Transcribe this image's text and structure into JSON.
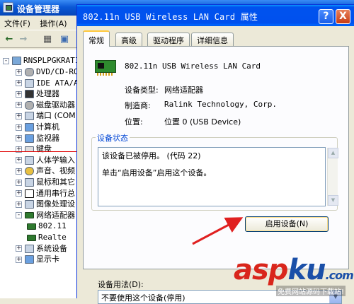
{
  "device_manager": {
    "title": "设备管理器",
    "menu": [
      "文件(F)",
      "操作(A)"
    ],
    "tree": {
      "root": "RNSPLPGKRATI",
      "items": [
        {
          "label": "DVD/CD-RO",
          "expander": "+",
          "icon": "dvd-icon"
        },
        {
          "label": "IDE ATA/A",
          "expander": "+",
          "icon": "ide-icon"
        },
        {
          "label": "处理器",
          "expander": "+",
          "icon": "cpu-icon"
        },
        {
          "label": "磁盘驱动器",
          "expander": "+",
          "icon": "disk-icon"
        },
        {
          "label": "端口 (COM",
          "expander": "+",
          "icon": "port-icon"
        },
        {
          "label": "计算机",
          "expander": "+",
          "icon": "computer-icon"
        },
        {
          "label": "监视器",
          "expander": "+",
          "icon": "monitor-icon"
        },
        {
          "label": "键盘",
          "expander": "+",
          "icon": "keyboard-icon"
        },
        {
          "label": "人体学输入",
          "expander": "+",
          "icon": "hid-icon"
        },
        {
          "label": "声音、视频",
          "expander": "+",
          "icon": "sound-icon"
        },
        {
          "label": "鼠标和其它",
          "expander": "+",
          "icon": "mouse-icon"
        },
        {
          "label": "通用串行总",
          "expander": "+",
          "icon": "usb-icon"
        },
        {
          "label": "图像处理设",
          "expander": "+",
          "icon": "camera-icon"
        },
        {
          "label": "网络适配器",
          "expander": "-",
          "icon": "network-icon"
        },
        {
          "label": "802.11",
          "expander": "",
          "icon": "network-card-icon",
          "child": true
        },
        {
          "label": "Realte",
          "expander": "",
          "icon": "network-card-icon",
          "child": true
        },
        {
          "label": "系统设备",
          "expander": "+",
          "icon": "system-icon"
        },
        {
          "label": "显示卡",
          "expander": "+",
          "icon": "display-icon"
        }
      ]
    }
  },
  "dialog": {
    "title": "802.11n USB Wireless LAN Card 属性",
    "help_btn": "?",
    "close_btn": "X",
    "tabs": [
      "常规",
      "高级",
      "驱动程序",
      "详细信息"
    ],
    "device_name": "802.11n USB Wireless LAN Card",
    "properties": [
      {
        "label": "设备类型:",
        "value": "网络适配器"
      },
      {
        "label": "制造商:",
        "value": "Ralink Technology, Corp."
      },
      {
        "label": "位置:",
        "value": "位置 0 (USB Device)"
      }
    ],
    "status": {
      "legend": "设备状态",
      "line1": "该设备已被停用。 (代码 22)",
      "line2": "单击“启用设备”启用这个设备。"
    },
    "enable_button": "启用设备(N)",
    "usage": {
      "label": "设备用法(D):",
      "selected": "不要使用这个设备(停用)"
    }
  },
  "watermark": {
    "logo_a": "asp",
    "logo_b": "ku",
    "suffix": ".com",
    "sub": "免费网站源码下载站!"
  },
  "colors": {
    "xp_title_blue": "#0053ee",
    "tab_accent": "#ffc83c",
    "arrow_red": "#e02020",
    "status_legend": "#0046d5"
  }
}
